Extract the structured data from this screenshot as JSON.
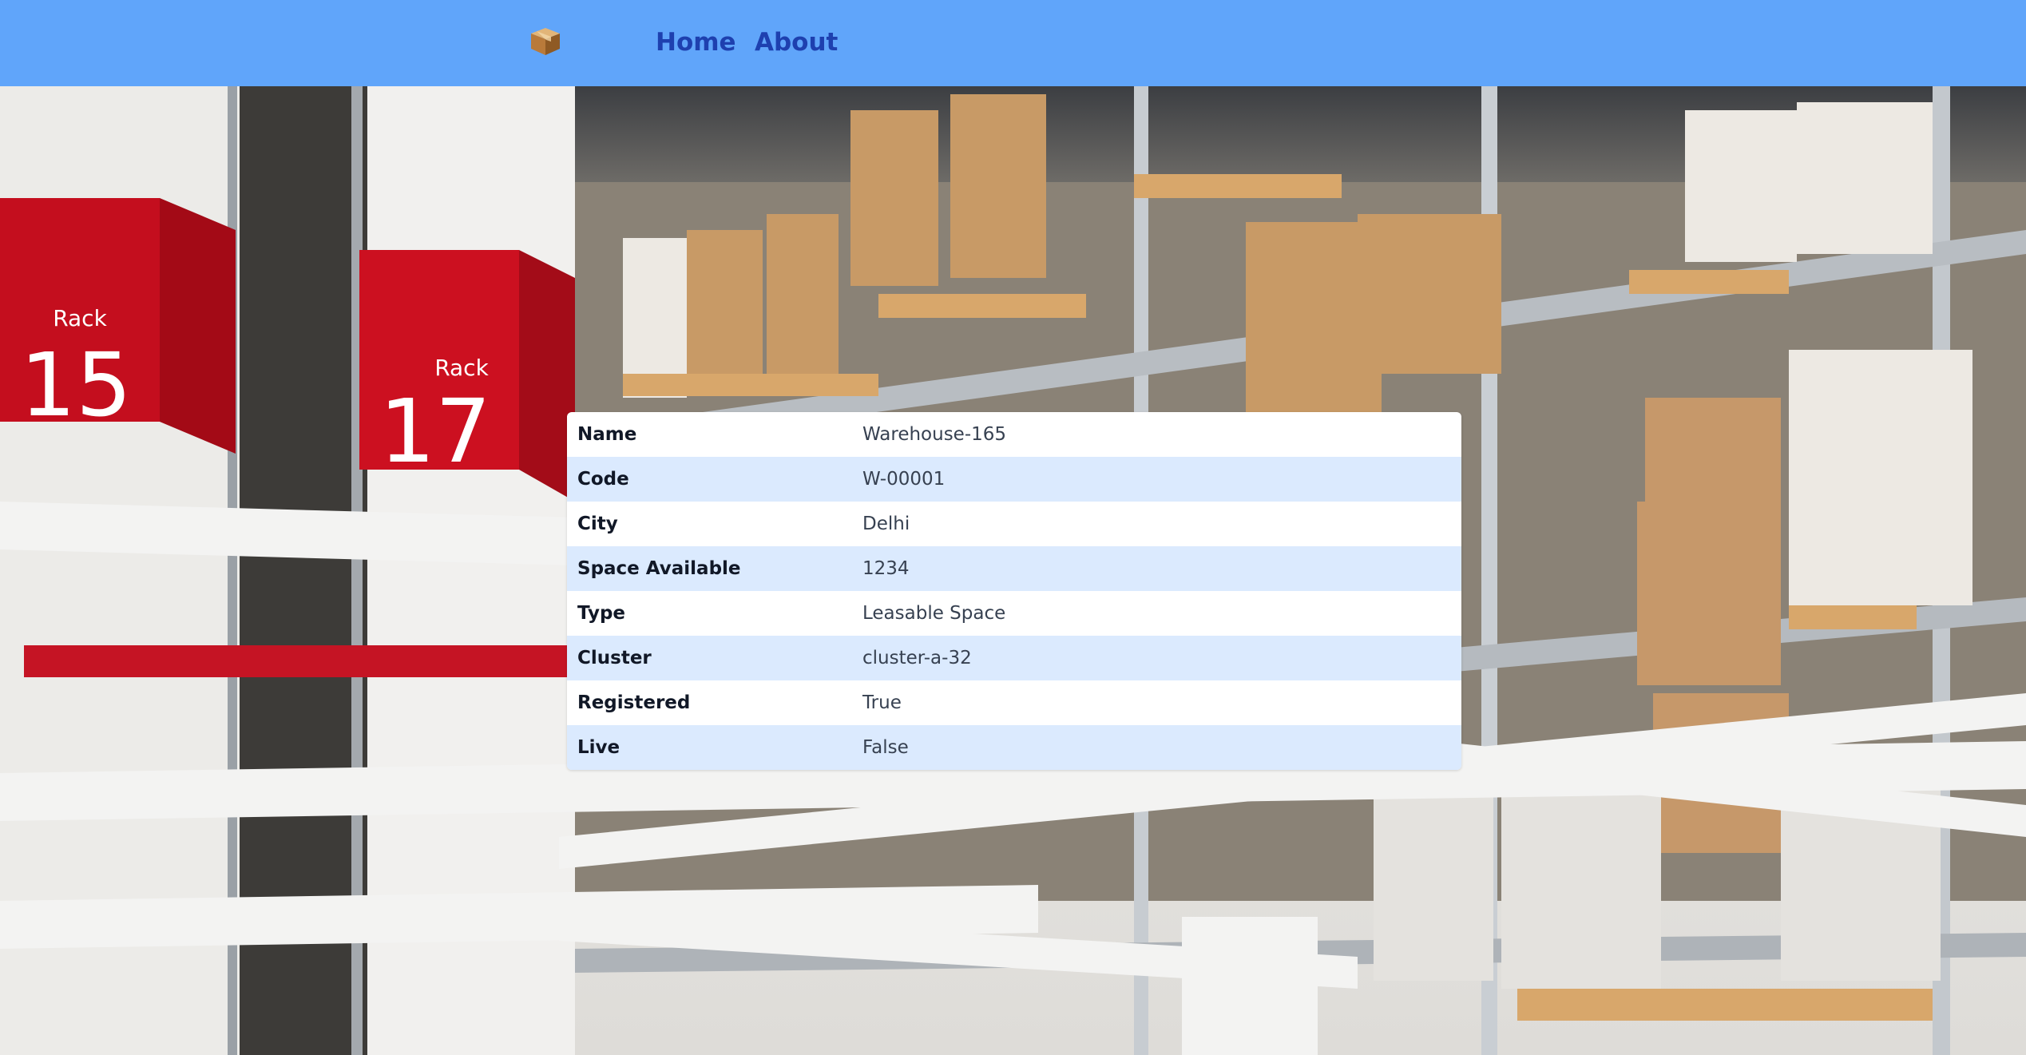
{
  "nav": {
    "logo_icon": "package-box-icon",
    "links": [
      {
        "label": "Home"
      },
      {
        "label": "About"
      }
    ],
    "colors": {
      "background": "#60a5fa",
      "link": "#1e40af"
    }
  },
  "background": {
    "rack_signs": [
      {
        "label": "Rack",
        "number": "15"
      },
      {
        "label": "Rack",
        "number": "17"
      }
    ]
  },
  "details": {
    "rows": [
      {
        "key": "Name",
        "value": "Warehouse-165"
      },
      {
        "key": "Code",
        "value": "W-00001"
      },
      {
        "key": "City",
        "value": "Delhi"
      },
      {
        "key": "Space Available",
        "value": "1234"
      },
      {
        "key": "Type",
        "value": "Leasable Space"
      },
      {
        "key": "Cluster",
        "value": "cluster-a-32"
      },
      {
        "key": "Registered",
        "value": "True"
      },
      {
        "key": "Live",
        "value": "False"
      }
    ],
    "colors": {
      "row_alt": "#dbeafe",
      "row": "#ffffff"
    }
  }
}
